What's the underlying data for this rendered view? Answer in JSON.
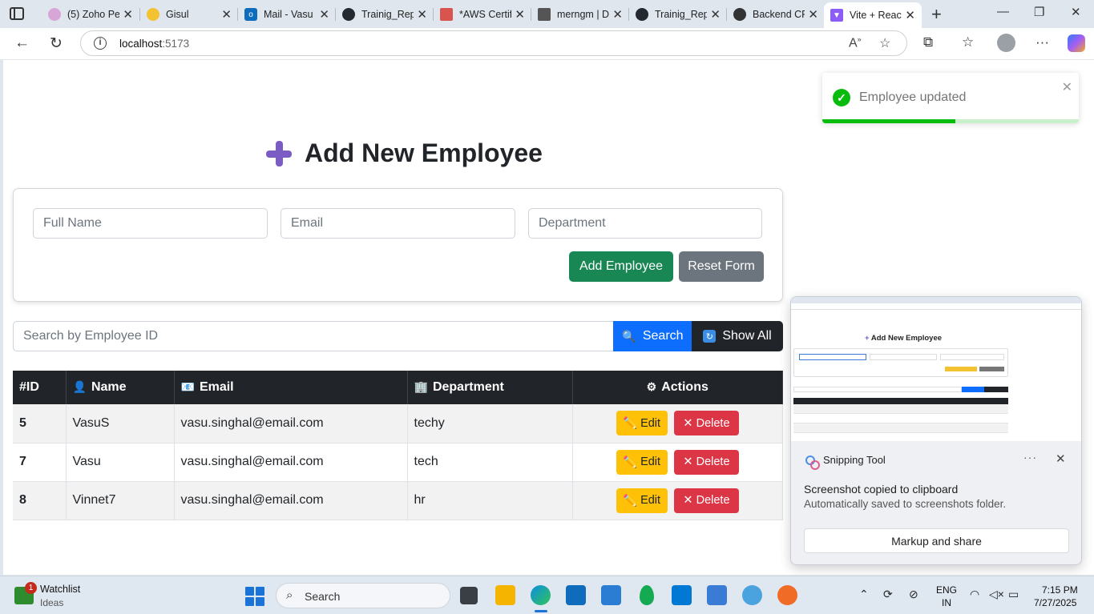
{
  "browser": {
    "tabs": [
      {
        "title": "(5) Zoho Pe",
        "fav_color": "#d8a6d6"
      },
      {
        "title": "Gisul",
        "fav_color": "#f2c230"
      },
      {
        "title": "Mail - Vasu",
        "fav_color": "#0f6cbd"
      },
      {
        "title": "Trainig_Rep",
        "fav_color": "#24292f"
      },
      {
        "title": "*AWS Certif",
        "fav_color": "#d9534f"
      },
      {
        "title": "merngm | D",
        "fav_color": "#555555"
      },
      {
        "title": "Trainig_Rep",
        "fav_color": "#24292f"
      },
      {
        "title": "Backend CR",
        "fav_color": "#333333"
      },
      {
        "title": "Vite + Reac",
        "fav_color": "#8c5cf6"
      }
    ],
    "url_host": "localhost",
    "url_port": ":5173"
  },
  "page": {
    "heading": "Add New Employee",
    "form": {
      "name_placeholder": "Full Name",
      "email_placeholder": "Email",
      "department_placeholder": "Department",
      "add_label": "Add Employee",
      "reset_label": "Reset Form"
    },
    "search": {
      "placeholder": "Search by Employee ID",
      "search_label": "Search",
      "showall_label": "Show All"
    },
    "table": {
      "headers": {
        "id": "#ID",
        "name": "Name",
        "email": "Email",
        "department": "Department",
        "actions": "Actions"
      },
      "rows": [
        {
          "id": "5",
          "name": "VasuS",
          "email": "vasu.singhal@email.com",
          "department": "techy"
        },
        {
          "id": "7",
          "name": "Vasu",
          "email": "vasu.singhal@email.com",
          "department": "tech"
        },
        {
          "id": "8",
          "name": "Vinnet7",
          "email": "vasu.singhal@email.com",
          "department": "hr"
        }
      ],
      "edit_label": "Edit",
      "delete_label": "Delete"
    }
  },
  "toast": {
    "message": "Employee updated",
    "progress": 0.52,
    "color": "#07bc0c"
  },
  "snipping": {
    "app": "Snipping Tool",
    "title": "Screenshot copied to clipboard",
    "subtitle": "Automatically saved to screenshots folder.",
    "button": "Markup and share"
  },
  "taskbar": {
    "badge": "1",
    "widget_title": "Watchlist",
    "widget_sub": "Ideas",
    "search_label": "Search",
    "lang1": "ENG",
    "lang2": "IN",
    "time": "7:15 PM",
    "date": "7/27/2025"
  }
}
